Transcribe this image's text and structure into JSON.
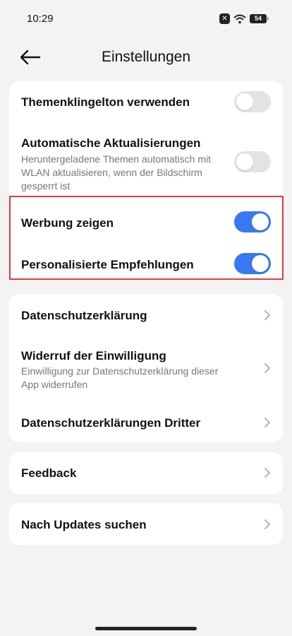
{
  "status_bar": {
    "time": "10:29",
    "battery": "54"
  },
  "header": {
    "title": "Einstellungen"
  },
  "theme_section": {
    "ringtone": {
      "label": "Themenklingelton verwenden",
      "enabled": false
    },
    "auto_update": {
      "label": "Automatische Aktualisierungen",
      "sublabel_line1": "Heruntergeladene Themen automatisch mit",
      "sublabel_line2": "WLAN aktualisieren, wenn der Bildschirm",
      "sublabel_line3": "gesperrt ist",
      "enabled": false
    },
    "show_ads": {
      "label": "Werbung zeigen",
      "enabled": true
    },
    "personalized": {
      "label": "Personalisierte Empfehlungen",
      "enabled": true
    }
  },
  "privacy_section": {
    "policy": {
      "label": "Datenschutzerklärung"
    },
    "revoke": {
      "label": "Widerruf der Einwilligung",
      "sublabel_line1": "Einwilligung zur Datenschutzerklärung dieser",
      "sublabel_line2": "App widerrufen"
    },
    "third_party": {
      "label": "Datenschutzerklärungen Dritter"
    }
  },
  "feedback": {
    "label": "Feedback"
  },
  "updates": {
    "label": "Nach Updates suchen"
  },
  "colors": {
    "accent": "#3a78f2",
    "highlight": "#e23b3b"
  }
}
